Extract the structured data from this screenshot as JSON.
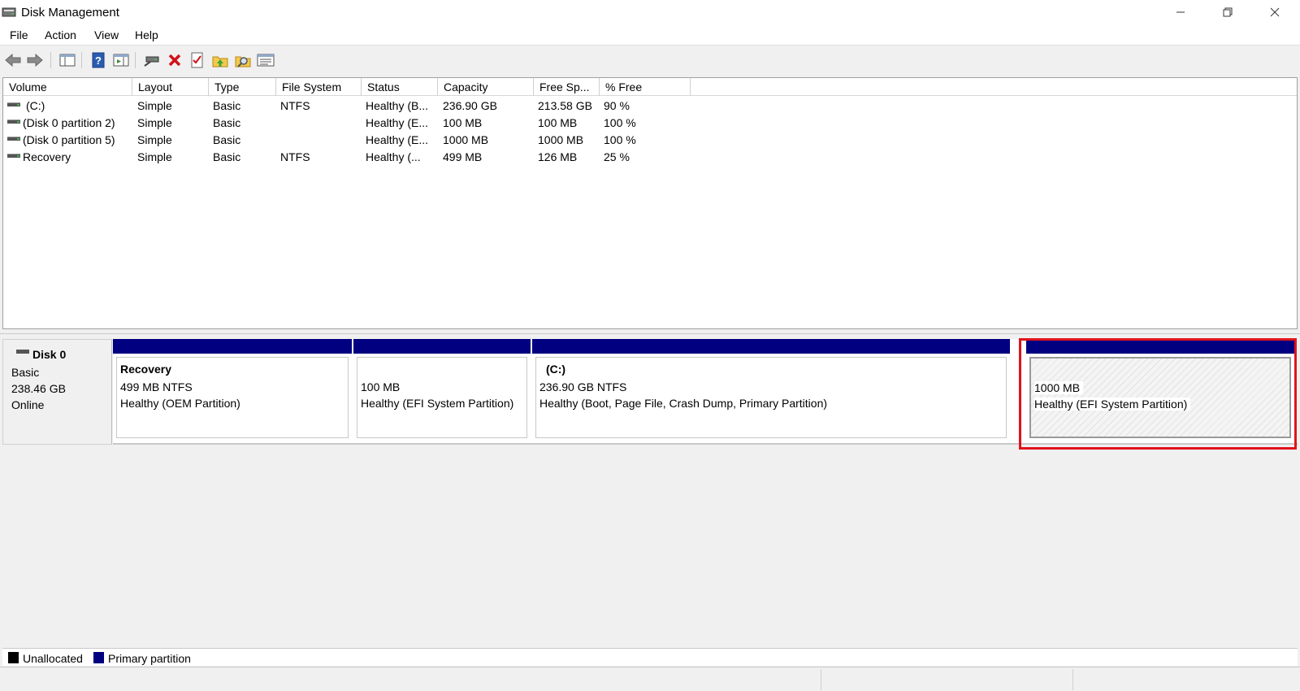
{
  "window": {
    "title": "Disk Management"
  },
  "menu": {
    "items": [
      "File",
      "Action",
      "View",
      "Help"
    ]
  },
  "volume_list": {
    "columns": [
      "Volume",
      "Layout",
      "Type",
      "File System",
      "Status",
      "Capacity",
      "Free Sp...",
      "% Free"
    ],
    "rows": [
      {
        "volume": "(C:)",
        "layout": "Simple",
        "type": "Basic",
        "fs": "NTFS",
        "status": "Healthy (B...",
        "capacity": "236.90 GB",
        "free": "213.58 GB",
        "pct": "90 %"
      },
      {
        "volume": "(Disk 0 partition 2)",
        "layout": "Simple",
        "type": "Basic",
        "fs": "",
        "status": "Healthy (E...",
        "capacity": "100 MB",
        "free": "100 MB",
        "pct": "100 %"
      },
      {
        "volume": "(Disk 0 partition 5)",
        "layout": "Simple",
        "type": "Basic",
        "fs": "",
        "status": "Healthy (E...",
        "capacity": "1000 MB",
        "free": "1000 MB",
        "pct": "100 %"
      },
      {
        "volume": "Recovery",
        "layout": "Simple",
        "type": "Basic",
        "fs": "NTFS",
        "status": "Healthy (...",
        "capacity": "499 MB",
        "free": "126 MB",
        "pct": "25 %"
      }
    ]
  },
  "disk": {
    "name": "Disk 0",
    "type": "Basic",
    "size": "238.46 GB",
    "state": "Online",
    "partitions": [
      {
        "name": "Recovery",
        "size": "499 MB NTFS",
        "status": "Healthy (OEM Partition)"
      },
      {
        "name": "",
        "size": "100 MB",
        "status": "Healthy (EFI System Partition)"
      },
      {
        "name": "(C:)",
        "size": "236.90 GB NTFS",
        "status": "Healthy (Boot, Page File, Crash Dump, Primary Partition)"
      },
      {
        "name": "",
        "size": "1000 MB",
        "status": "Healthy (EFI System Partition)"
      }
    ]
  },
  "legend": {
    "items": [
      {
        "label": "Unallocated",
        "color": "#000000"
      },
      {
        "label": "Primary partition",
        "color": "#000080"
      }
    ]
  },
  "colors": {
    "primary_partition": "#000080",
    "highlight": "#e0131b"
  }
}
